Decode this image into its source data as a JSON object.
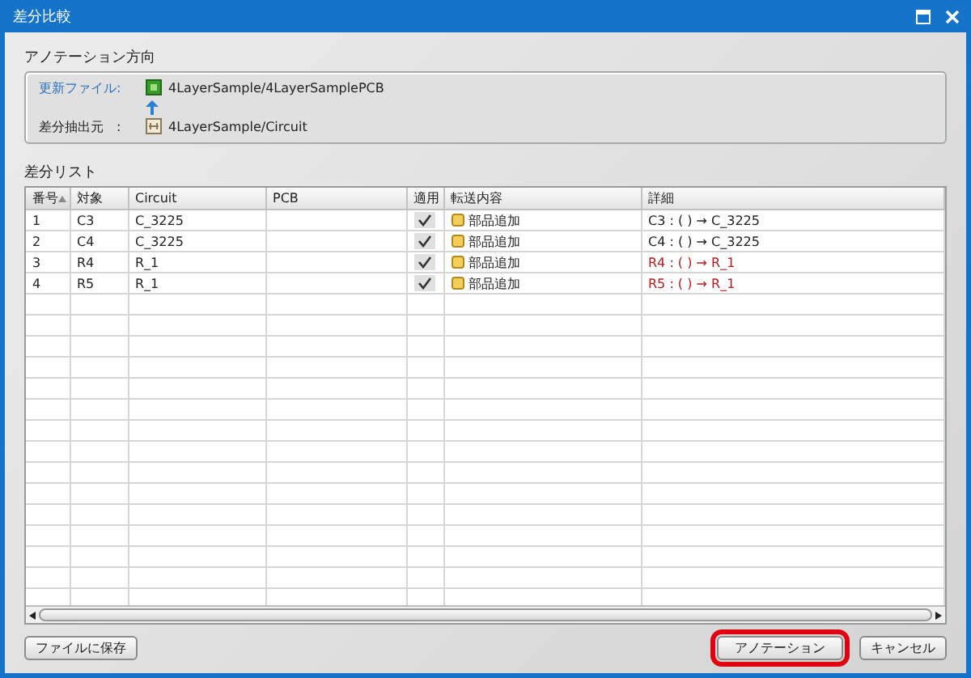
{
  "window": {
    "title": "差分比較"
  },
  "direction": {
    "title": "アノテーション方向",
    "target": {
      "label": "更新ファイル:",
      "path": "4LayerSample/4LayerSamplePCB"
    },
    "source": {
      "label": "差分抽出元　:",
      "path": "4LayerSample/Circuit"
    }
  },
  "diff_list": {
    "title": "差分リスト",
    "columns": [
      {
        "label": "番号",
        "sorted": true
      },
      {
        "label": "対象",
        "sorted": false
      },
      {
        "label": "Circuit",
        "sorted": false
      },
      {
        "label": "PCB",
        "sorted": false
      },
      {
        "label": "適用",
        "sorted": false
      },
      {
        "label": "転送内容",
        "sorted": false
      },
      {
        "label": "詳細",
        "sorted": false
      }
    ],
    "rows": [
      {
        "no": "1",
        "target": "C3",
        "circuit": "C_3225",
        "applied": true,
        "transfer": "部品追加",
        "detail": "C3 : (  ) → C_3225",
        "flagged": false
      },
      {
        "no": "2",
        "target": "C4",
        "circuit": "C_3225",
        "applied": true,
        "transfer": "部品追加",
        "detail": "C4 : (  ) → C_3225",
        "flagged": false
      },
      {
        "no": "3",
        "target": "R4",
        "circuit": "R_1",
        "applied": true,
        "transfer": "部品追加",
        "detail": "R4 : (  ) → R_1",
        "flagged": true
      },
      {
        "no": "4",
        "target": "R5",
        "circuit": "R_1",
        "applied": true,
        "transfer": "部品追加",
        "detail": "R5 : (  ) → R_1",
        "flagged": true
      }
    ]
  },
  "buttons": [
    {
      "label": "ファイルに保存",
      "highlighted": false
    },
    {
      "label": "アノテーション",
      "highlighted": true
    },
    {
      "label": "キャンセル",
      "highlighted": false
    }
  ]
}
